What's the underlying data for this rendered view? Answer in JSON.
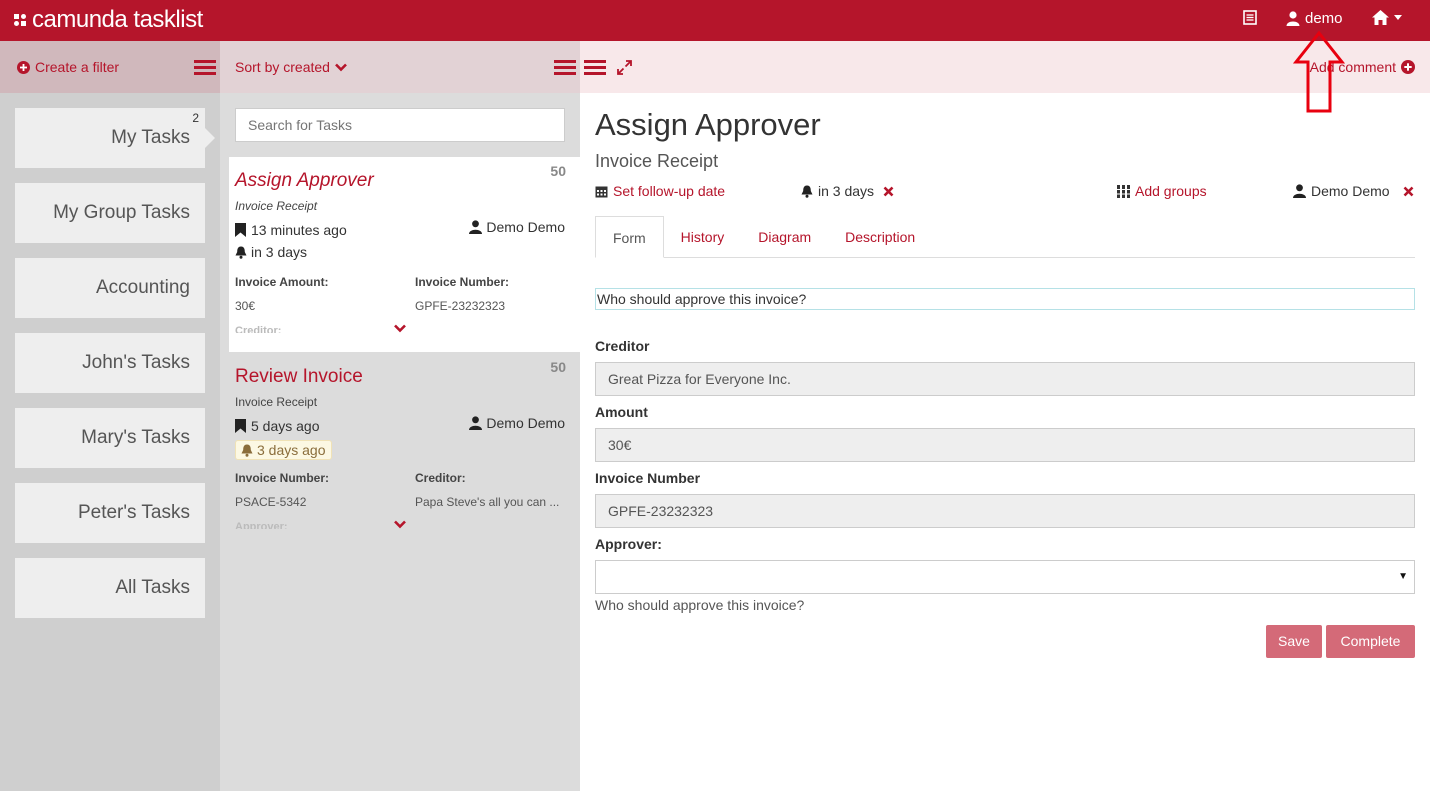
{
  "header": {
    "brand": "camunda tasklist",
    "user": "demo",
    "icons": [
      "list-icon",
      "user-icon",
      "home-icon"
    ]
  },
  "filters": {
    "create_label": "Create a filter",
    "items": [
      {
        "label": "My Tasks",
        "count": "2"
      },
      {
        "label": "My Group Tasks"
      },
      {
        "label": "Accounting"
      },
      {
        "label": "John's Tasks"
      },
      {
        "label": "Mary's Tasks"
      },
      {
        "label": "Peter's Tasks"
      },
      {
        "label": "All Tasks"
      }
    ]
  },
  "tasklist": {
    "sort_label": "Sort by created",
    "search_placeholder": "Search for Tasks",
    "tasks": [
      {
        "name": "Assign Approver",
        "process": "Invoice Receipt",
        "priority": "50",
        "created": "13 minutes ago",
        "assignee": "Demo Demo",
        "due": "in 3 days",
        "vars": [
          {
            "label": "Invoice Amount:",
            "value": "30€"
          },
          {
            "label": "Invoice Number:",
            "value": "GPFE-23232323"
          }
        ],
        "more_label": "Creditor:"
      },
      {
        "name": "Review Invoice",
        "process": "Invoice Receipt",
        "priority": "50",
        "created": "5 days ago",
        "assignee": "Demo Demo",
        "due": "3 days ago",
        "vars": [
          {
            "label": "Invoice Number:",
            "value": "PSACE-5342"
          },
          {
            "label": "Creditor:",
            "value": "Papa Steve's all you can ..."
          }
        ],
        "more_label": "Approver:"
      }
    ]
  },
  "detail": {
    "add_comment": "Add comment",
    "title": "Assign Approver",
    "subtitle": "Invoice Receipt",
    "follow_up": "Set follow-up date",
    "due": "in 3 days",
    "add_groups": "Add groups",
    "assignee": "Demo Demo",
    "tabs": [
      "Form",
      "History",
      "Diagram",
      "Description"
    ],
    "active_tab": "Form",
    "form": {
      "question": "Who should approve this invoice?",
      "creditor_label": "Creditor",
      "creditor_value": "Great Pizza for Everyone Inc.",
      "amount_label": "Amount",
      "amount_value": "30€",
      "invoice_number_label": "Invoice Number",
      "invoice_number_value": "GPFE-23232323",
      "approver_label": "Approver:",
      "approver_value": "",
      "approver_help": "Who should approve this invoice?",
      "save_label": "Save",
      "complete_label": "Complete"
    }
  },
  "colors": {
    "brand": "#b5152b",
    "button": "#d46a78",
    "annotation": "#e8000f"
  }
}
